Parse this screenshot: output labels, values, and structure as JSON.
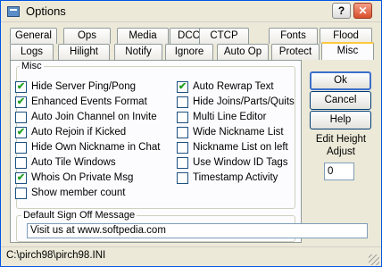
{
  "window": {
    "title": "Options",
    "help_glyph": "?",
    "close_glyph": "✕"
  },
  "tabs": {
    "row1": [
      "General",
      "Ops",
      "Media",
      "DCC",
      "CTCP",
      "Fonts",
      "Flood"
    ],
    "row2": [
      "Logs",
      "Hilight",
      "Notify",
      "Ignore",
      "Auto Op",
      "Protect",
      "Misc"
    ],
    "active": "Misc"
  },
  "misc": {
    "group_label": "Misc",
    "left": [
      {
        "label": "Hide Server Ping/Pong",
        "checked": true
      },
      {
        "label": "Enhanced Events Format",
        "checked": true
      },
      {
        "label": "Auto Join Channel on Invite",
        "checked": false
      },
      {
        "label": "Auto Rejoin if Kicked",
        "checked": true
      },
      {
        "label": "Hide Own Nickname in Chat",
        "checked": false
      },
      {
        "label": "Auto Tile Windows",
        "checked": false
      },
      {
        "label": "Whois On Private Msg",
        "checked": true
      },
      {
        "label": "Show member count",
        "checked": false
      }
    ],
    "right": [
      {
        "label": "Auto Rewrap Text",
        "checked": true
      },
      {
        "label": "Hide Joins/Parts/Quits",
        "checked": false
      },
      {
        "label": "Multi Line Editor",
        "checked": false
      },
      {
        "label": "Wide Nickname List",
        "checked": false
      },
      {
        "label": "Nickname List on left",
        "checked": false
      },
      {
        "label": "Use Window ID Tags",
        "checked": false
      },
      {
        "label": "Timestamp Activity",
        "checked": false
      }
    ]
  },
  "signoff": {
    "label": "Default Sign Off Message",
    "value": "Visit us at www.softpedia.com"
  },
  "buttons": {
    "ok": "Ok",
    "cancel": "Cancel",
    "help": "Help"
  },
  "edit_height": {
    "label": "Edit Height Adjust",
    "value": "0"
  },
  "status": {
    "path": "C:\\pirch98\\pirch98.INI"
  },
  "check_glyph": "✔"
}
